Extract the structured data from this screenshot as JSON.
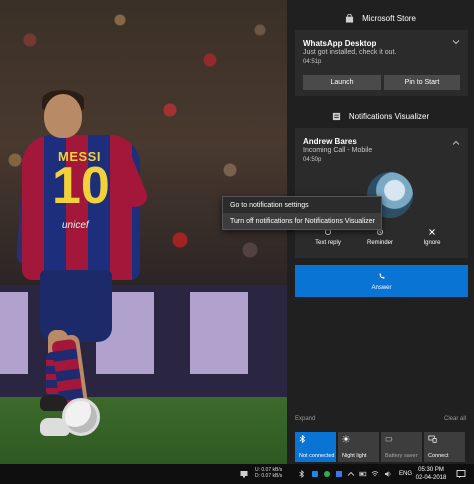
{
  "colors": {
    "panel_bg": "#202020",
    "card_bg": "#2b2b2b",
    "button_bg": "#4a4a4a",
    "accent": "#0a74d5",
    "taskbar_bg": "#0f0f0f"
  },
  "wallpaper": {
    "jersey_name": "MESSI",
    "jersey_number": "10",
    "jersey_sponsor": "unicef"
  },
  "action_center": {
    "groups": [
      {
        "app_name": "Microsoft Store",
        "icon": "store-bag-icon",
        "notification": {
          "title": "WhatsApp Desktop",
          "body": "Just got installed, check it out.",
          "time": "04:51p",
          "buttons": [
            "Launch",
            "Pin to Start"
          ]
        }
      },
      {
        "app_name": "Notifications Visualizer",
        "icon": "notifications-app-icon",
        "notification": {
          "title": "Andrew Bares",
          "body": "Incoming Call - Mobile",
          "time": "04:50p",
          "actions": [
            {
              "label": "Text reply",
              "icon": "chat-icon"
            },
            {
              "label": "Reminder",
              "icon": "reminder-icon"
            },
            {
              "label": "Ignore",
              "icon": "close-icon"
            }
          ],
          "primary_action": {
            "label": "Answer",
            "icon": "phone-icon"
          }
        }
      }
    ],
    "context_menu": {
      "items": [
        "Go to notification settings",
        "Turn off notifications for Notifications Visualizer"
      ]
    },
    "footer": {
      "expand": "Expand",
      "clear_all": "Clear all"
    },
    "quick_actions": [
      {
        "label": "Not connected",
        "icon": "bluetooth-icon",
        "state": "on"
      },
      {
        "label": "Night light",
        "icon": "brightness-icon",
        "state": "off"
      },
      {
        "label": "Battery saver",
        "icon": "battery-saver-icon",
        "state": "disabled"
      },
      {
        "label": "Connect",
        "icon": "connect-icon",
        "state": "off"
      }
    ]
  },
  "taskbar": {
    "net_upload_label": "U:",
    "net_upload": "0.07 kB/s",
    "net_download_label": "D:",
    "net_download": "0.07 kB/s",
    "language": "ENG",
    "time": "05:30 PM",
    "date": "02-04-2018"
  }
}
